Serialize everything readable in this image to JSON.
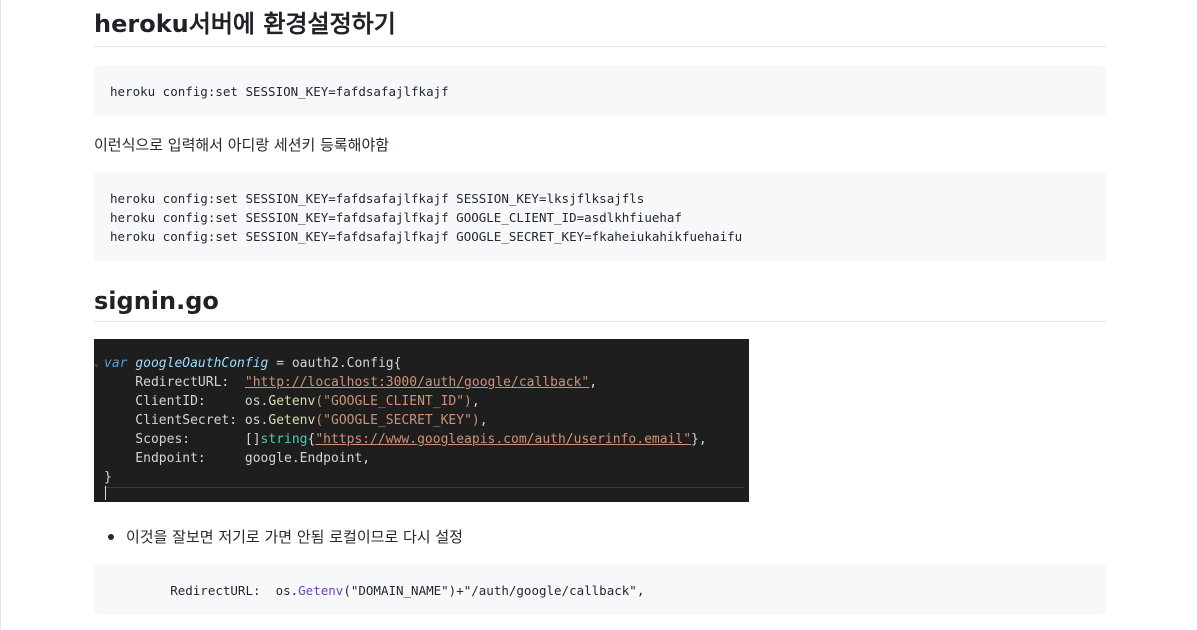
{
  "heading_heroku": "heroku서버에 환경설정하기",
  "code1": [
    "heroku config:set SESSION_KEY=fafdsafajlfkajf"
  ],
  "para1": "이런식으로 입력해서 아디랑 세션키 등록해야함",
  "code2": [
    "heroku config:set SESSION_KEY=fafdsafajlfkajf SESSION_KEY=lksjflksajfls",
    "heroku config:set SESSION_KEY=fafdsafajlfkajf GOOGLE_CLIENT_ID=asdlkhfiuehaf",
    "heroku config:set SESSION_KEY=fafdsafajlfkajf GOOGLE_SECRET_KEY=fkaheiukahikfuehaifu"
  ],
  "heading_signin": "signin.go",
  "dark_code": {
    "line1_kw": "var",
    "line1_var": "googleOauthConfig",
    "line1_rest": " = oauth2.Config{",
    "line2_key": "    RedirectURL:  ",
    "line2_url": "\"http://localhost:3000/auth/google/callback\"",
    "line2_end": ",",
    "line3_key": "    ClientID:     os.",
    "line3_fn": "Getenv",
    "line3_str": "(\"GOOGLE_CLIENT_ID\")",
    "line3_end": ",",
    "line4_key": "    ClientSecret: os.",
    "line4_fn": "Getenv",
    "line4_str": "(\"GOOGLE_SECRET_KEY\")",
    "line4_end": ",",
    "line5_key": "    Scopes:       []",
    "line5_type": "string",
    "line5_brace": "{",
    "line5_url": "\"https://www.googleapis.com/auth/userinfo.email\"",
    "line5_end": "},",
    "line6": "    Endpoint:     google.Endpoint,",
    "line7": "}"
  },
  "bullet1": "이것을 잘보면 저기로 가면 안됨 로컬이므로 다시 설정",
  "code3": {
    "prefix": "        RedirectURL:  os.",
    "fn": "Getenv",
    "str": "(\"DOMAIN_NAME\")+\"/auth/google/callback\"",
    "end": ","
  }
}
